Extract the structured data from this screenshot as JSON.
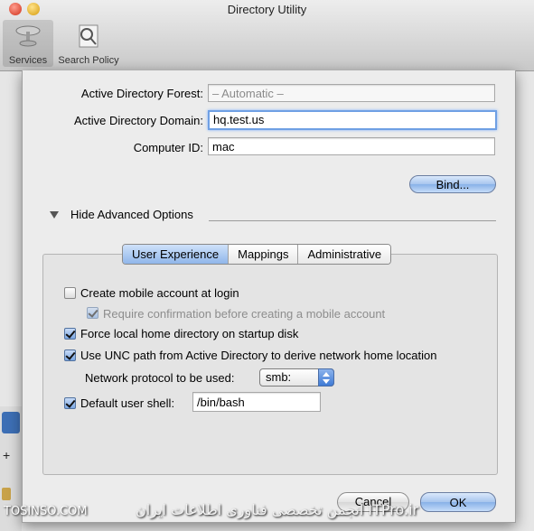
{
  "window": {
    "title": "Directory Utility"
  },
  "toolbar": {
    "services_label": "Services",
    "search_policy_label": "Search Policy"
  },
  "form": {
    "forest_label": "Active Directory Forest:",
    "forest_placeholder": "– Automatic –",
    "domain_label": "Active Directory Domain:",
    "domain_value": "hq.test.us",
    "computer_id_label": "Computer ID:",
    "computer_id_value": "mac",
    "bind_button": "Bind..."
  },
  "advanced": {
    "toggle_label": "Hide Advanced Options",
    "tabs": [
      {
        "label": "User Experience",
        "active": true
      },
      {
        "label": "Mappings",
        "active": false
      },
      {
        "label": "Administrative",
        "active": false
      }
    ],
    "options": {
      "mobile_account": {
        "label": "Create mobile account at login",
        "checked": false
      },
      "require_confirmation": {
        "label": "Require confirmation before creating a mobile account",
        "checked": true,
        "enabled": false
      },
      "force_local_home": {
        "label": "Force local home directory on startup disk",
        "checked": true
      },
      "use_unc": {
        "label": "Use UNC path from Active Directory to derive network home location",
        "checked": true
      },
      "protocol_label": "Network protocol to be used:",
      "protocol_value": "smb:",
      "default_shell": {
        "label": "Default user shell:",
        "checked": true
      },
      "shell_value": "/bin/bash"
    }
  },
  "buttons": {
    "cancel": "Cancel",
    "ok": "OK"
  },
  "watermark": {
    "left": "TOSINSO.COM",
    "right": "انجمن تخصصی فناوری اطلاعات ایران ITPro.ir"
  }
}
